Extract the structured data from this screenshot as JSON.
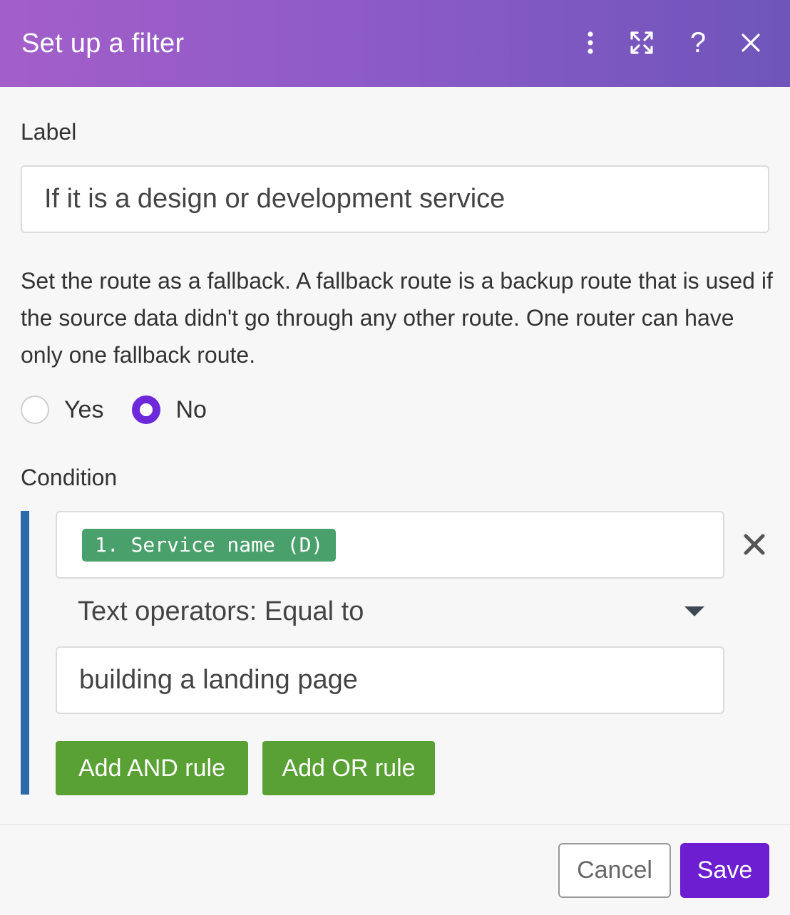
{
  "dialog": {
    "title": "Set up a filter",
    "icons": {
      "menu": "vertical-dots-icon",
      "expand": "expand-icon",
      "help": "help-icon",
      "close": "close-icon"
    },
    "help_glyph": "?"
  },
  "label_field": {
    "heading": "Label",
    "value": "If it is a design or development service"
  },
  "fallback": {
    "description": "Set the route as a fallback. A fallback route is a backup route that is used if the source data didn't go through any other route. One router can have only one fallback route.",
    "options": [
      {
        "label": "Yes",
        "checked": false
      },
      {
        "label": "No",
        "checked": true
      }
    ]
  },
  "condition": {
    "heading": "Condition",
    "field_pill": "1. Service name (D)",
    "operator": "Text operators: Equal to",
    "value": "building a landing page",
    "add_and_label": "Add AND rule",
    "add_or_label": "Add OR rule"
  },
  "footer": {
    "cancel_label": "Cancel",
    "save_label": "Save"
  },
  "colors": {
    "header_gradient_start": "#a35ec9",
    "header_gradient_end": "#6e55ba",
    "radio_checked": "#6d28d9",
    "condition_bar": "#2e6aa8",
    "pill": "#4aa06a",
    "rule_button": "#5aa135",
    "save_button": "#6d1ed0"
  }
}
